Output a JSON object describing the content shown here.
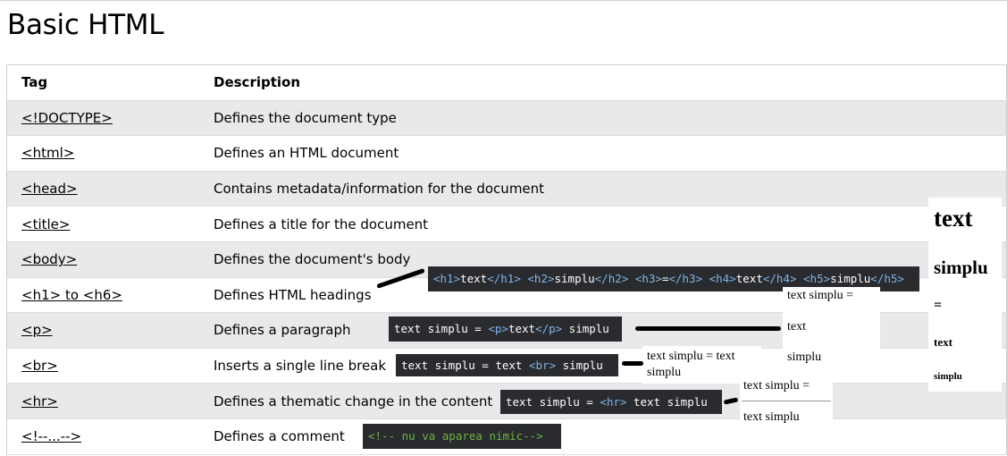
{
  "page": {
    "title": "Basic HTML"
  },
  "table": {
    "headers": [
      "Tag",
      "Description"
    ],
    "rows": [
      {
        "tag": "<!DOCTYPE>",
        "desc": "Defines the document type"
      },
      {
        "tag": "<html>",
        "desc": "Defines an HTML document"
      },
      {
        "tag": "<head>",
        "desc": "Contains metadata/information for the document"
      },
      {
        "tag": "<title>",
        "desc": "Defines a title for the document"
      },
      {
        "tag": "<body>",
        "desc": "Defines the document's body"
      },
      {
        "tag": "<h1> to <h6>",
        "desc": "Defines HTML headings"
      },
      {
        "tag": "<p>",
        "desc": "Defines a paragraph"
      },
      {
        "tag": "<br>",
        "desc": "Inserts a single line break"
      },
      {
        "tag": "<hr>",
        "desc": "Defines a thematic change in the content"
      },
      {
        "tag": "<!--...-->",
        "desc": "Defines a comment"
      }
    ]
  },
  "annotations": {
    "headings_code": {
      "open1": "<h1>",
      "text1": "text",
      "close1": "</h1>",
      "open2": "<h2>",
      "text2": "simplu",
      "close2": "</h2>",
      "open3": "<h3>",
      "text3": "=",
      "close3": "</h3>",
      "open4": "<h4>",
      "text4": "text",
      "close4": "</h4>",
      "open5": "<h5>",
      "text5": "simplu",
      "close5": "</h5>"
    },
    "headings_output": {
      "h1": "text",
      "h2": "simplu",
      "h3": "=",
      "h4": "text",
      "h5": "simplu"
    },
    "p_code": {
      "before": "text simplu = ",
      "open": "<p>",
      "inner": "text",
      "close": "</p>",
      "after": " simplu"
    },
    "p_output": {
      "line1": "text simplu =",
      "line2": "text",
      "line3": "simplu"
    },
    "br_code": {
      "before": "text simplu = text ",
      "tag": "<br>",
      "after": " simplu"
    },
    "br_output": {
      "line1": "text simplu = text",
      "line2": "simplu"
    },
    "hr_code": {
      "before": "text simplu = ",
      "tag": "<hr>",
      "after": " text simplu"
    },
    "hr_output": {
      "line1": "text simplu =",
      "line2": "text simplu"
    },
    "comment_code": {
      "text": "<!-- nu va aparea nimic-->"
    }
  },
  "colors": {
    "code_bg": "#292b2e",
    "tag": "#7fb4e8",
    "comment": "#6fb23f",
    "row_alt": "#e7e9eb"
  }
}
